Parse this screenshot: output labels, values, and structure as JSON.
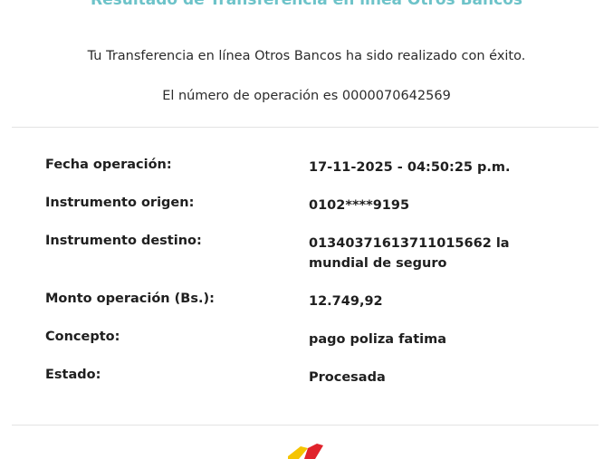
{
  "header": {
    "title": "Resultado de Transferencia en línea Otros Bancos"
  },
  "messages": {
    "success": "Tu Transferencia en línea Otros Bancos ha sido realizado con éxito.",
    "operation_number": "El número de operación es 0000070642569"
  },
  "details": [
    {
      "label": "Fecha operación:",
      "value": "17-11-2025 - 04:50:25 p.m."
    },
    {
      "label": "Instrumento origen:",
      "value": "0102****9195"
    },
    {
      "label": "Instrumento destino:",
      "value": "01340371613711015662 la mundial de seguro"
    },
    {
      "label": "Monto operación (Bs.):",
      "value": "12.749,92"
    },
    {
      "label": "Concepto:",
      "value": "pago poliza fatima"
    },
    {
      "label": "Estado:",
      "value": "Procesada"
    }
  ],
  "colors": {
    "title_teal": "#6dc3c9",
    "logo_yellow": "#f5c400",
    "logo_red": "#e0222b",
    "divider": "#e3e3e3"
  },
  "icons": {
    "bank_logo": "bank-logo-icon"
  }
}
